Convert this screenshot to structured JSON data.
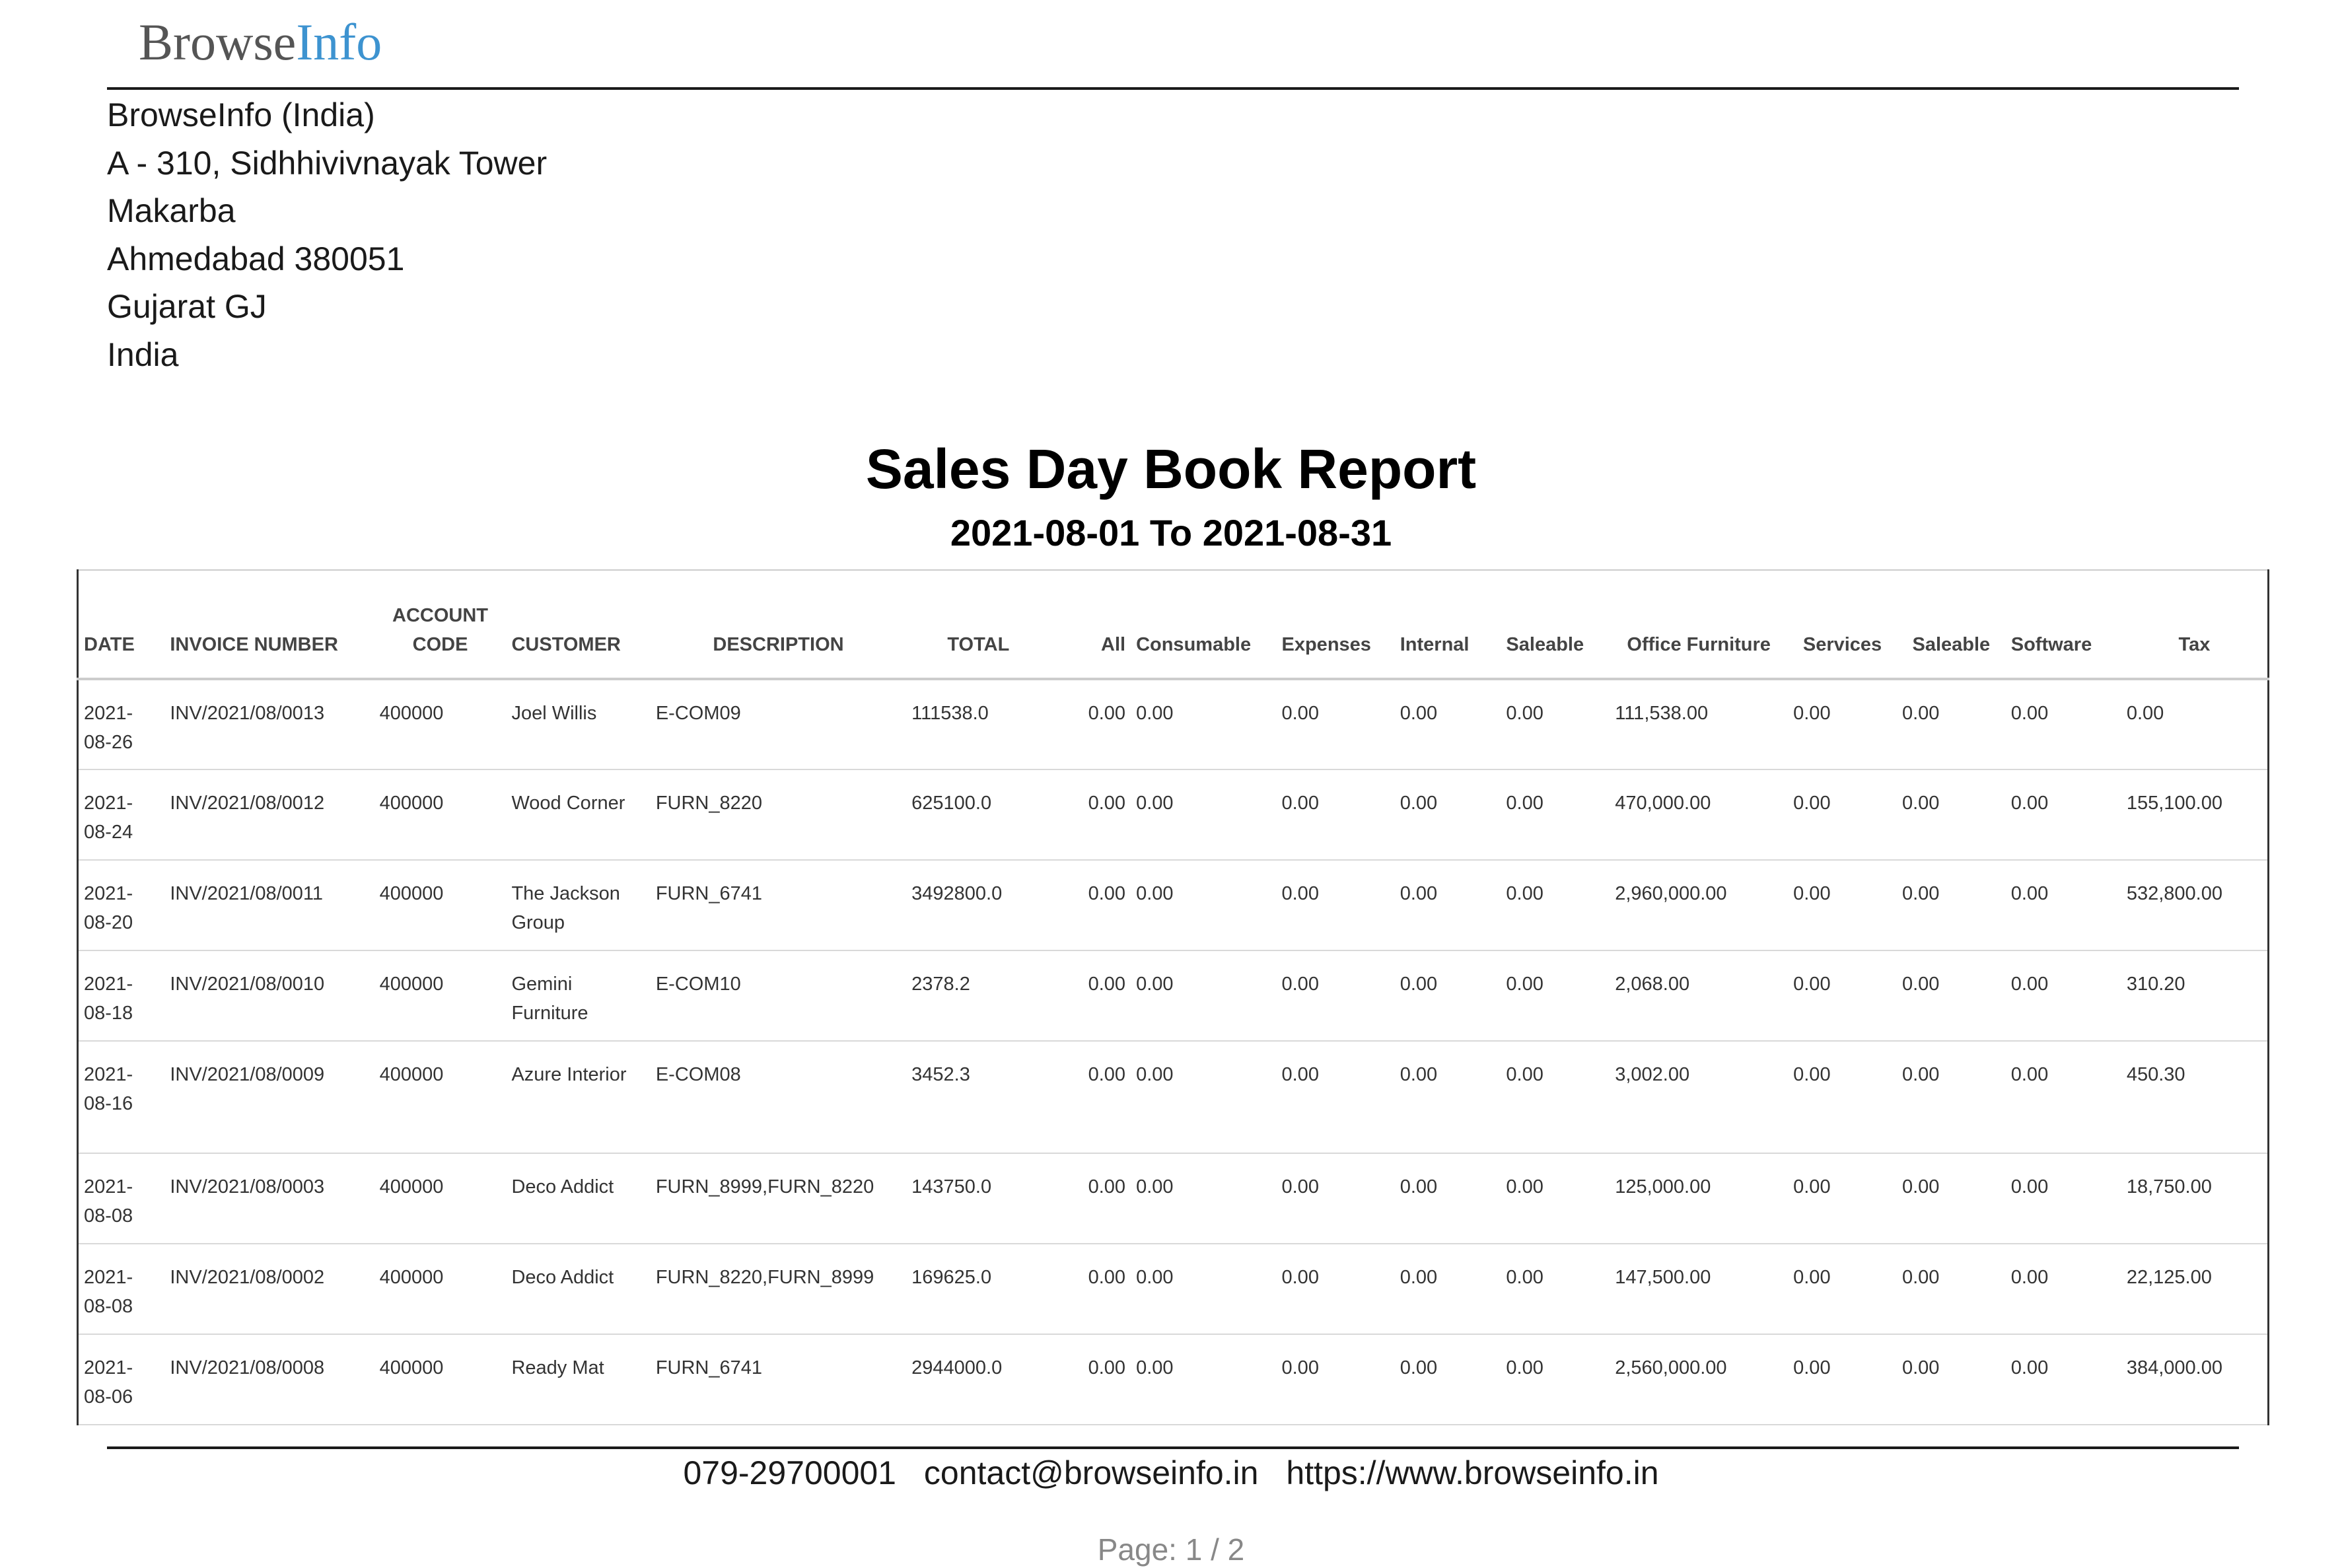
{
  "logo": {
    "part1": "Browse",
    "part2": "Info"
  },
  "company": {
    "lines": [
      "BrowseInfo (India)",
      "A - 310, Sidhhivivnayak Tower",
      "Makarba",
      "Ahmedabad 380051",
      "Gujarat GJ",
      "India"
    ]
  },
  "report": {
    "title": "Sales Day Book Report",
    "period": "2021-08-01 To 2021-08-31"
  },
  "table": {
    "headers": [
      "DATE",
      "INVOICE NUMBER",
      "ACCOUNT CODE",
      "CUSTOMER",
      "DESCRIPTION",
      "TOTAL",
      "All",
      "Consumable",
      "Expenses",
      "Internal",
      "Saleable",
      "Office Furniture",
      "Services",
      "Saleable",
      "Software",
      "Tax"
    ],
    "rows": [
      [
        "2021-08-26",
        "INV/2021/08/0013",
        "400000",
        "Joel Willis",
        "E-COM09",
        "111538.0",
        "0.00",
        "0.00",
        "0.00",
        "0.00",
        "0.00",
        "111,538.00",
        "0.00",
        "0.00",
        "0.00",
        "0.00"
      ],
      [
        "2021-08-24",
        "INV/2021/08/0012",
        "400000",
        "Wood Corner",
        "FURN_8220",
        "625100.0",
        "0.00",
        "0.00",
        "0.00",
        "0.00",
        "0.00",
        "470,000.00",
        "0.00",
        "0.00",
        "0.00",
        "155,100.00"
      ],
      [
        "2021-08-20",
        "INV/2021/08/0011",
        "400000",
        "The Jackson Group",
        "FURN_6741",
        "3492800.0",
        "0.00",
        "0.00",
        "0.00",
        "0.00",
        "0.00",
        "2,960,000.00",
        "0.00",
        "0.00",
        "0.00",
        "532,800.00"
      ],
      [
        "2021-08-18",
        "INV/2021/08/0010",
        "400000",
        "Gemini Furniture",
        "E-COM10",
        "2378.2",
        "0.00",
        "0.00",
        "0.00",
        "0.00",
        "0.00",
        "2,068.00",
        "0.00",
        "0.00",
        "0.00",
        "310.20"
      ],
      [
        "2021-08-16",
        "INV/2021/08/0009",
        "400000",
        "Azure Interior",
        "E-COM08",
        "3452.3",
        "0.00",
        "0.00",
        "0.00",
        "0.00",
        "0.00",
        "3,002.00",
        "0.00",
        "0.00",
        "0.00",
        "450.30"
      ],
      [
        "2021-08-08",
        "INV/2021/08/0003",
        "400000",
        "Deco Addict",
        "FURN_8999,FURN_8220",
        "143750.0",
        "0.00",
        "0.00",
        "0.00",
        "0.00",
        "0.00",
        "125,000.00",
        "0.00",
        "0.00",
        "0.00",
        "18,750.00"
      ],
      [
        "2021-08-08",
        "INV/2021/08/0002",
        "400000",
        "Deco Addict",
        "FURN_8220,FURN_8999",
        "169625.0",
        "0.00",
        "0.00",
        "0.00",
        "0.00",
        "0.00",
        "147,500.00",
        "0.00",
        "0.00",
        "0.00",
        "22,125.00"
      ],
      [
        "2021-08-06",
        "INV/2021/08/0008",
        "400000",
        "Ready Mat",
        "FURN_6741",
        "2944000.0",
        "0.00",
        "0.00",
        "0.00",
        "0.00",
        "0.00",
        "2,560,000.00",
        "0.00",
        "0.00",
        "0.00",
        "384,000.00"
      ]
    ]
  },
  "footer": {
    "phone": "079-29700001",
    "email": "contact@browseinfo.in",
    "website": "https://www.browseinfo.in",
    "page": "Page: 1 / 2"
  }
}
